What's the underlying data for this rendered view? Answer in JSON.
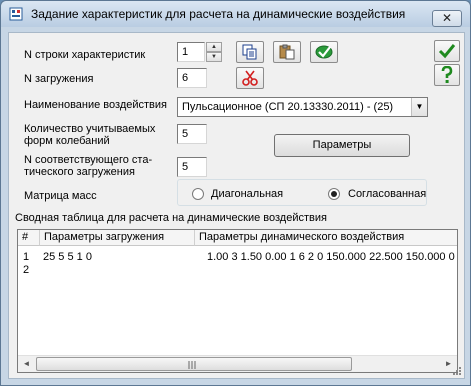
{
  "window": {
    "title": "Задание характеристик для расчета на динамические воздействия",
    "close_glyph": "✕"
  },
  "form": {
    "row_label": "N строки характеристик",
    "row_value": "1",
    "load_label": "N загружения",
    "load_value": "6",
    "impact_label": "Наименование воздействия",
    "impact_value": "Пульсационное (СП 20.13330.2011) - (25)",
    "forms_label_1": "Количество учитываемых",
    "forms_label_2": "форм колебаний",
    "forms_value": "5",
    "static_label_1": "N соответствующего ста-",
    "static_label_2": "тического загружения",
    "static_value": "5",
    "params_button": "Параметры",
    "mass_label": "Матрица масс",
    "mass_options": [
      {
        "label": "Диагональная",
        "checked": false
      },
      {
        "label": "Согласованная",
        "checked": true
      }
    ]
  },
  "table": {
    "caption": "Сводная таблица для расчета на динамические воздействия",
    "columns": [
      "#",
      "Параметры загружения",
      "Параметры динамического воздействия"
    ],
    "rows": [
      {
        "num": "1",
        "load_params": "25 5 5 1 0",
        "dyn_params": "1.00 3 1.50 0.00 1 6 2 0 150.000 22.500 150.000 0.30"
      },
      {
        "num": "2",
        "load_params": "",
        "dyn_params": ""
      }
    ]
  },
  "icons": {
    "accept": "check-icon",
    "help": "help-icon",
    "copy": "copy-icon",
    "paste": "paste-icon",
    "apply": "apply-icon",
    "delete": "scissors-icon"
  },
  "colors": {
    "title_bar": "#c7d6e5",
    "accept_green": "#1f8a1f",
    "delete_red": "#d21e1e"
  }
}
